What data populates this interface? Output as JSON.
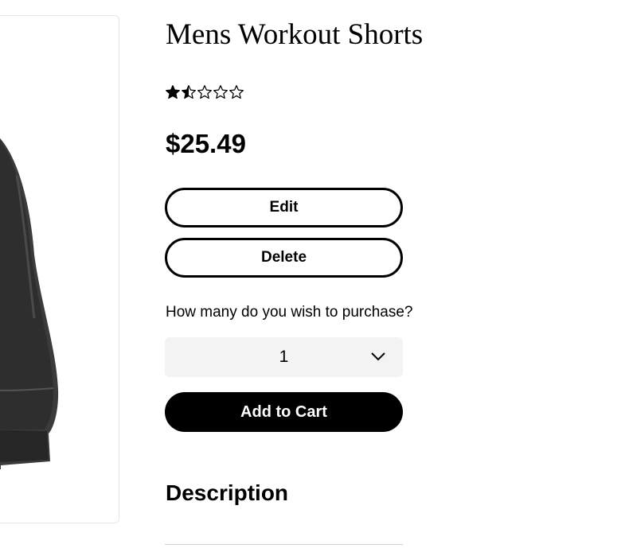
{
  "product": {
    "title": "Mens Workout Shorts",
    "rating": 1.5,
    "rating_max": 5,
    "price": "$25.49",
    "image_icon": "workout-shorts-photo"
  },
  "actions": {
    "edit_label": "Edit",
    "delete_label": "Delete"
  },
  "purchase": {
    "quantity_prompt": "How many do you wish to purchase?",
    "quantity_value": "1",
    "add_to_cart_label": "Add to Cart"
  },
  "description": {
    "heading": "Description"
  },
  "colors": {
    "button_dark": "#000000",
    "select_bg": "#f3f3f3",
    "divider": "#cfcfcf"
  }
}
